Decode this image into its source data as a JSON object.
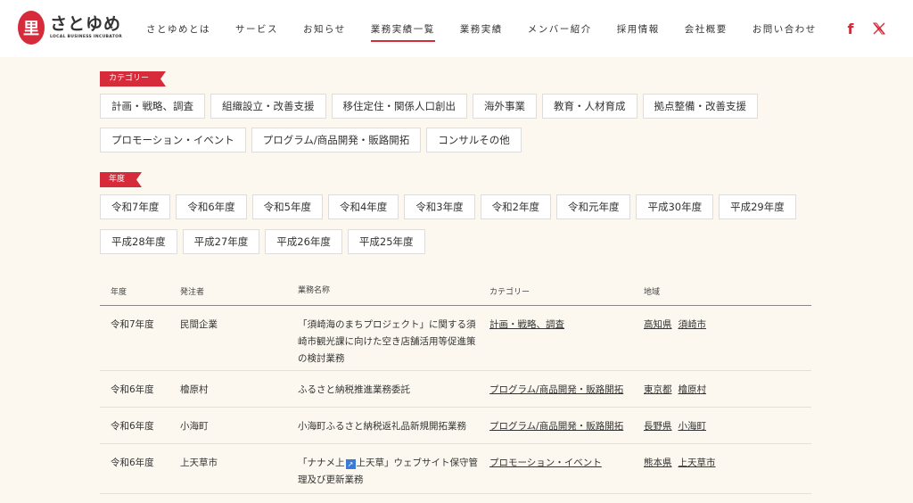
{
  "header": {
    "logo_mark": "里",
    "logo_main": "さとゆめ",
    "logo_sub": "LOCAL BUSINESS INCUBATOR",
    "nav": [
      {
        "label": "さとゆめとは",
        "active": false
      },
      {
        "label": "サービス",
        "active": false
      },
      {
        "label": "お知らせ",
        "active": false
      },
      {
        "label": "業務実績一覧",
        "active": true
      },
      {
        "label": "業務実績",
        "active": false
      },
      {
        "label": "メンバー紹介",
        "active": false
      },
      {
        "label": "採用情報",
        "active": false
      },
      {
        "label": "会社概要",
        "active": false
      },
      {
        "label": "お問い合わせ",
        "active": false
      }
    ],
    "facebook_glyph": "f"
  },
  "category": {
    "label": "カテゴリー",
    "row1": [
      "計画・戦略、調査",
      "組織設立・改善支援",
      "移住定住・関係人口創出",
      "海外事業",
      "教育・人材育成",
      "拠点整備・改善支援"
    ],
    "row2": [
      "プロモーション・イベント",
      "プログラム/商品開発・販路開拓",
      "コンサルその他"
    ]
  },
  "year": {
    "label": "年度",
    "row1": [
      "令和7年度",
      "令和6年度",
      "令和5年度",
      "令和4年度",
      "令和3年度",
      "令和2年度",
      "令和元年度",
      "平成30年度",
      "平成29年度"
    ],
    "row2": [
      "平成28年度",
      "平成27年度",
      "平成26年度",
      "平成25年度"
    ]
  },
  "table": {
    "headers": [
      "年度",
      "発注者",
      "業務名称",
      "カテゴリー",
      "地域"
    ],
    "rows": [
      {
        "year": "令和7年度",
        "client": "民間企業",
        "name": "「須崎海のまちプロジェクト」に関する須崎市観光課に向けた空き店舗活用等促進策の検討業務",
        "category": "計画・戦略、調査",
        "pref": "高知県",
        "city": "須崎市"
      },
      {
        "year": "令和6年度",
        "client": "檜原村",
        "name": "ふるさと納税推進業務委託",
        "category": "プログラム/商品開発・販路開拓",
        "pref": "東京都",
        "city": "檜原村"
      },
      {
        "year": "令和6年度",
        "client": "小海町",
        "name": "小海町ふるさと納税返礼品新規開拓業務",
        "category": "プログラム/商品開発・販路開拓",
        "pref": "長野県",
        "city": "小海町"
      },
      {
        "year": "令和6年度",
        "client": "上天草市",
        "name_before": "「ナナメ上",
        "name_after": "上天草」ウェブサイト保守管理及び更新業務",
        "category": "プロモーション・イベント",
        "pref": "熊本県",
        "city": "上天草市"
      }
    ]
  },
  "colors": {
    "accent": "#d52b3a",
    "background": "#fcf8ef"
  }
}
